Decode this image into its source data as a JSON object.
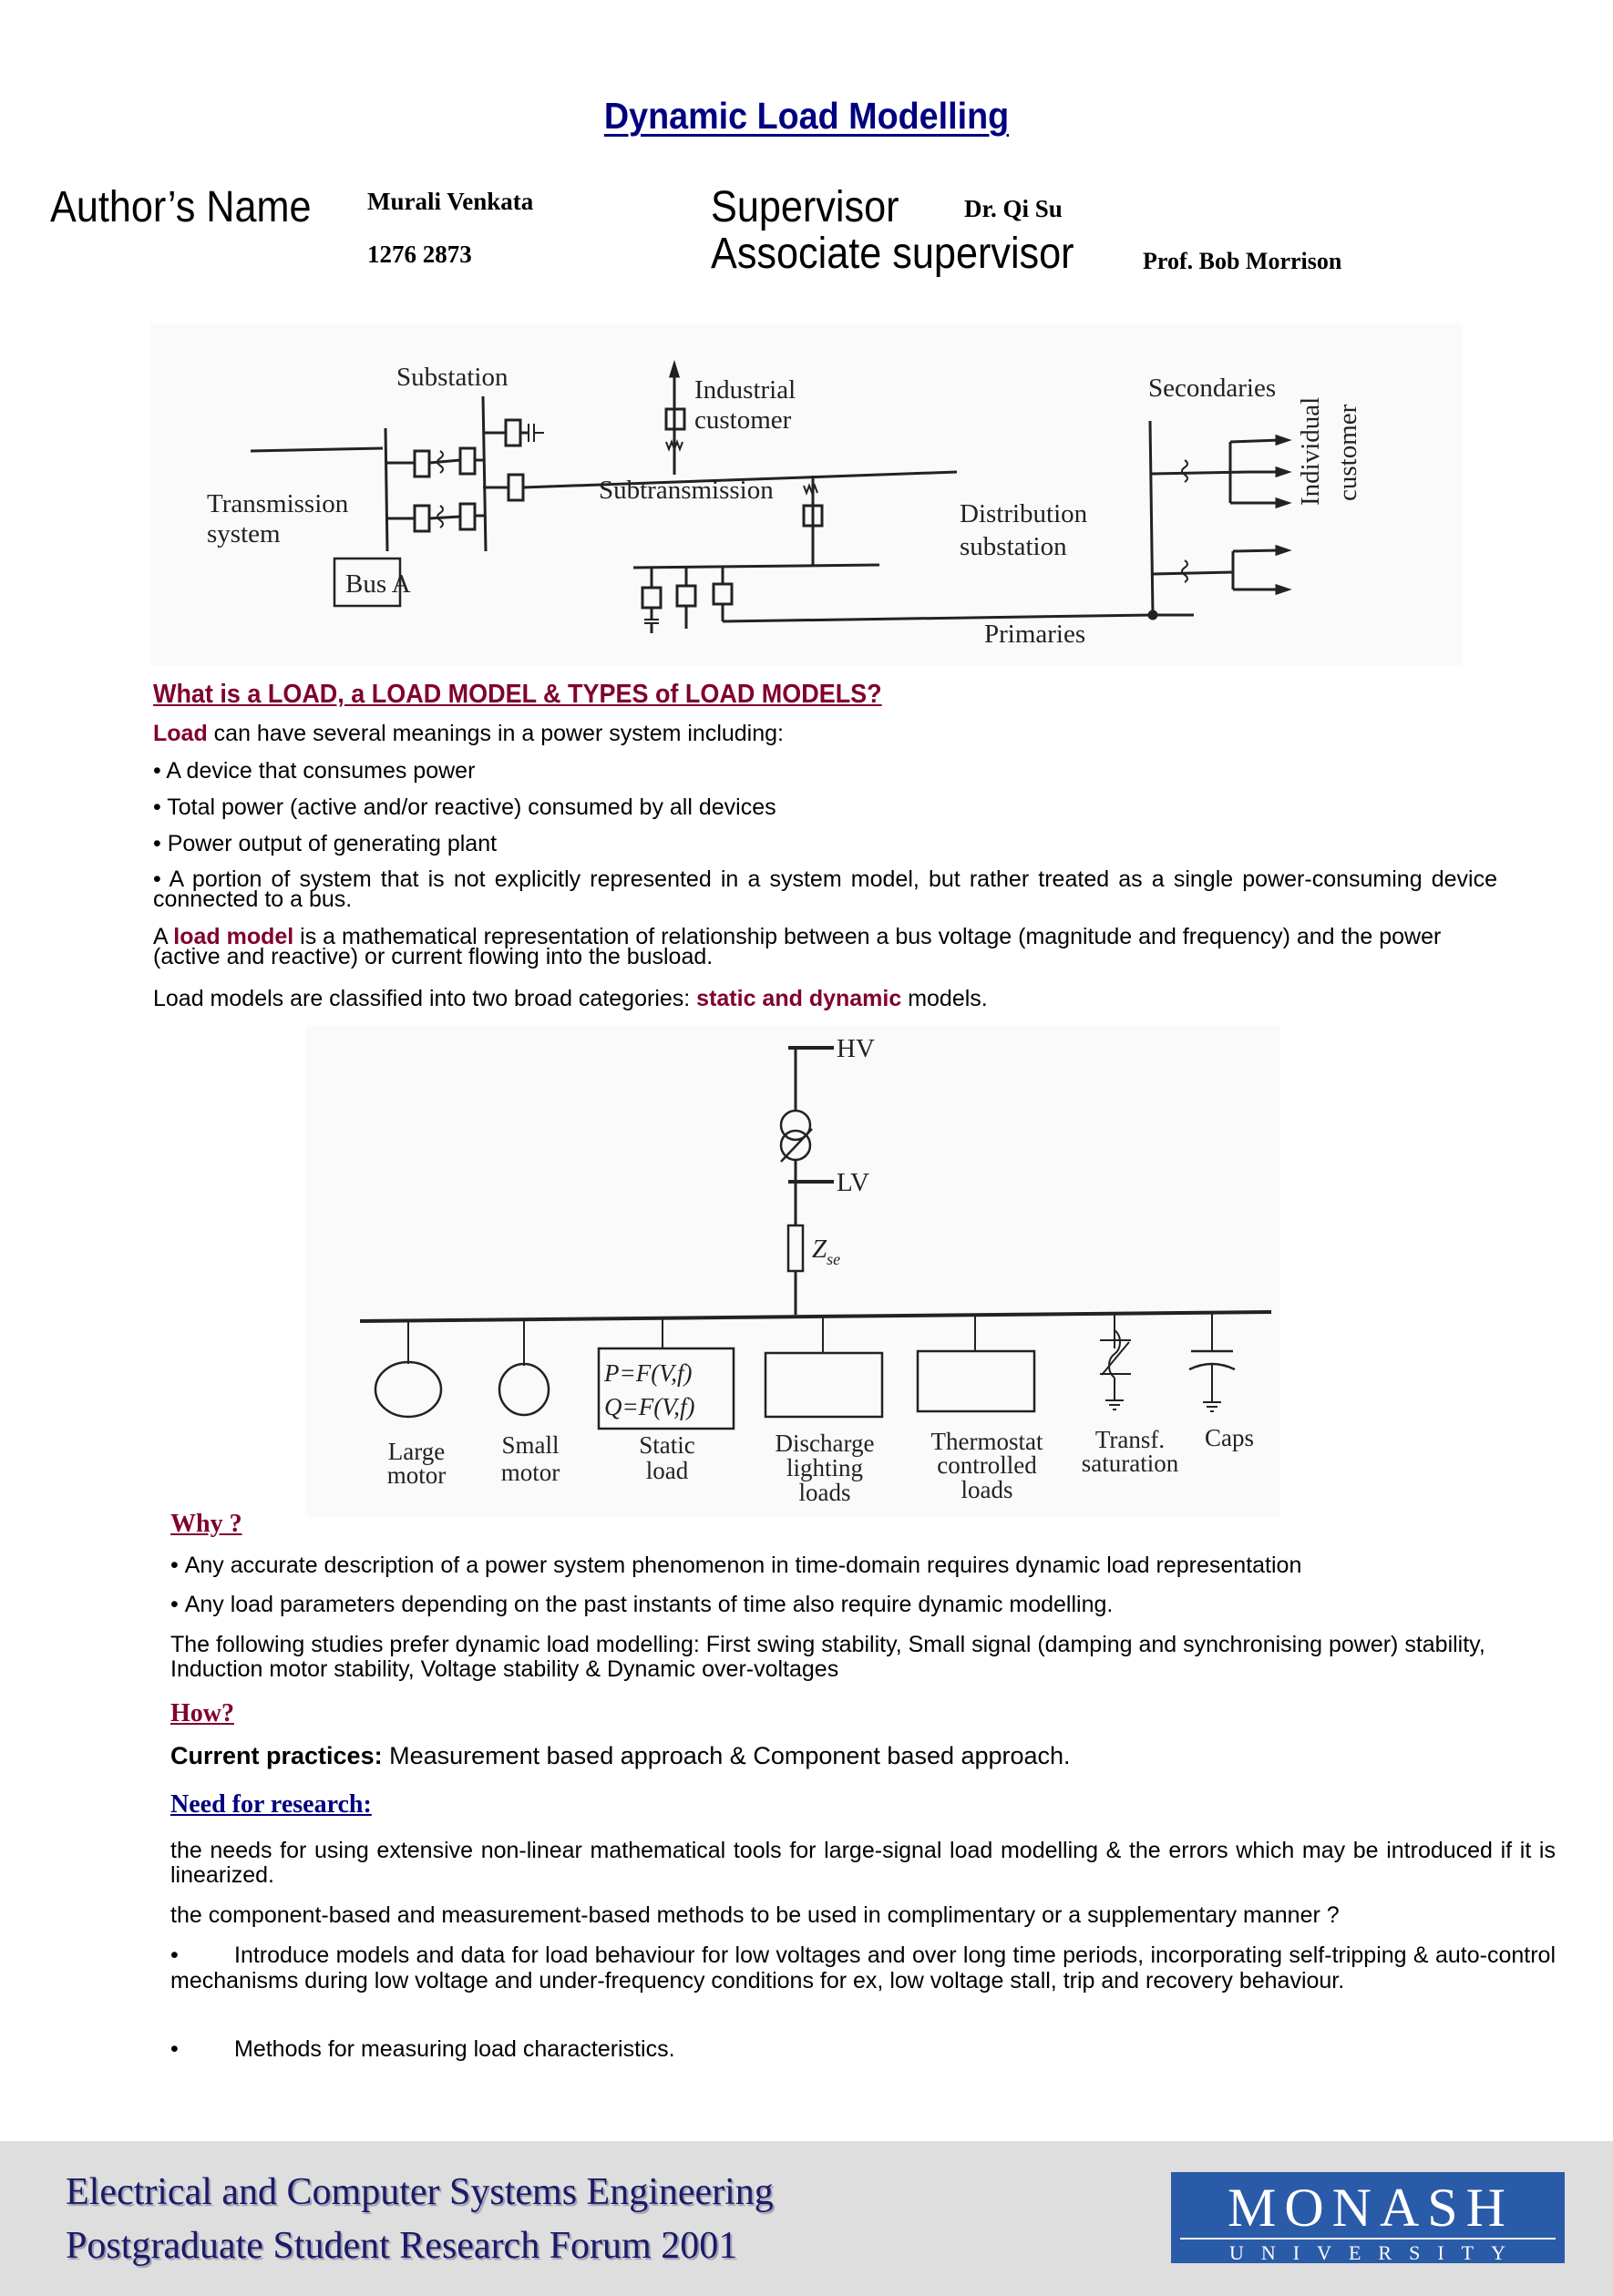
{
  "title": "Dynamic Load Modelling",
  "header": {
    "author_label": "Author’s Name",
    "author_name": "Murali Venkata",
    "student_id": "1276 2873",
    "supervisor_label": "Supervisor",
    "supervisor_name": "Dr. Qi Su",
    "assoc_supervisor_label": "Associate supervisor",
    "assoc_supervisor_name": "Prof. Bob Morrison"
  },
  "diagram1": {
    "labels": {
      "substation": "Substation",
      "transmission_1": "Transmission",
      "transmission_2": "system",
      "bus_a": "Bus A",
      "subtransmission": "Subtransmission",
      "industrial_1": "Industrial",
      "industrial_2": "customer",
      "distribution_1": "Distribution",
      "distribution_2": "substation",
      "primaries": "Primaries",
      "secondaries": "Secondaries",
      "individual_1": "Individual",
      "individual_2": "customer"
    }
  },
  "section1": {
    "heading": "What is a LOAD, a LOAD MODEL & TYPES of LOAD MODELS?",
    "intro_bold": "Load",
    "intro_rest": " can have several meanings in a power system including:",
    "bullets": [
      "• A device that consumes power",
      "• Total power (active and/or reactive) consumed by all devices",
      "• Power output of generating plant",
      "• A portion of system that is not explicitly represented in a system model, but rather treated as a single power-consuming device connected to a bus."
    ],
    "model_pre": "A ",
    "model_bold": "load model",
    "model_rest": " is a mathematical representation of relationship between a bus voltage (magnitude and frequency) and the power (active and reactive) or current flowing into the busload.",
    "classify_pre": "Load models are classified into two broad categories: ",
    "classify_bold": "static and dynamic",
    "classify_rest": " models."
  },
  "diagram2": {
    "hv": "HV",
    "lv": "LV",
    "zse_main": "Z",
    "zse_sub": "se",
    "static_eq1": "P=F(V,f)",
    "static_eq2": "Q=F(V,f)",
    "loads": [
      {
        "line1": "Large",
        "line2": "motor",
        "line3": ""
      },
      {
        "line1": "Small",
        "line2": "motor",
        "line3": ""
      },
      {
        "line1": "Static",
        "line2": "load",
        "line3": ""
      },
      {
        "line1": "Discharge",
        "line2": "lighting",
        "line3": "loads"
      },
      {
        "line1": "Thermostat",
        "line2": "controlled",
        "line3": "loads"
      },
      {
        "line1": "Transf.",
        "line2": "saturation",
        "line3": ""
      },
      {
        "line1": "Caps",
        "line2": "",
        "line3": ""
      }
    ]
  },
  "why": {
    "heading": "Why ?",
    "bullets": [
      "Any accurate description of a power system phenomenon in time-domain requires dynamic load representation",
      "Any load parameters depending on the past instants of time also require dynamic modelling."
    ],
    "studies": "The following studies prefer dynamic load modelling: First swing stability, Small signal (damping and synchronising power) stability, Induction motor stability, Voltage stability & Dynamic over-voltages"
  },
  "how": {
    "heading": "How?",
    "current_bold": "Current practices:",
    "current_rest": " Measurement based approach & Component based approach."
  },
  "need": {
    "heading": "Need for research: ",
    "para1": " the needs for using extensive non-linear mathematical tools for large-signal load modelling & the errors which may be introduced if it is linearized.",
    "para2": "the component-based and measurement-based methods to be used in complimentary or a supplementary manner ?",
    "bullets": [
      "Introduce models and data for load behaviour for low voltages and over long time periods, incorporating self-tripping & auto-control mechanisms during low voltage and under-frequency conditions for ex, low voltage stall, trip and recovery behaviour.",
      "Methods for measuring load characteristics."
    ]
  },
  "footer": {
    "line1": "Electrical and Computer Systems Engineering",
    "line2": "Postgraduate Student Research Forum 2001",
    "logo_top": "MONASH",
    "logo_bottom": "UNIVERSITY"
  },
  "colors": {
    "title_navy": "#000080",
    "section_maroon": "#800030",
    "footer_gray": "#dedede",
    "monash_blue": "#2a5ba8"
  }
}
